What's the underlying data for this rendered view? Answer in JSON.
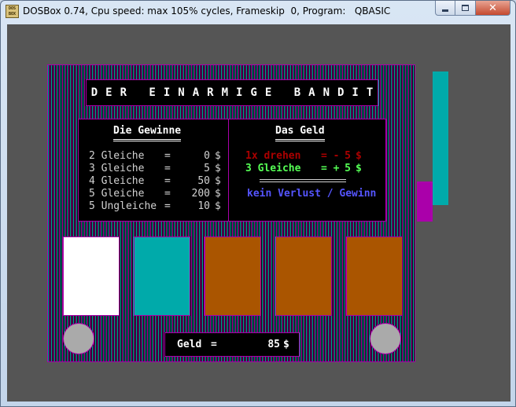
{
  "window": {
    "title": "DOSBox 0.74, Cpu speed: max 105% cycles, Frameskip  0, Program:   QBASIC",
    "icon_text": "DOS BOX",
    "controls": [
      "minimize",
      "maximize",
      "close"
    ]
  },
  "game": {
    "title": "DER EINARMIGE BANDIT",
    "payouts_heading": "Die Gewinne",
    "payouts": [
      {
        "name": "2 Gleiche",
        "eq": "=",
        "value": "0",
        "currency": "$"
      },
      {
        "name": "3 Gleiche",
        "eq": "=",
        "value": "5",
        "currency": "$"
      },
      {
        "name": "4 Gleiche",
        "eq": "=",
        "value": "50",
        "currency": "$"
      },
      {
        "name": "5 Gleiche",
        "eq": "=",
        "value": "200",
        "currency": "$"
      },
      {
        "name": "5 Ungleiche",
        "eq": "=",
        "value": "10",
        "currency": "$"
      }
    ],
    "money_heading": "Das Geld",
    "cost": {
      "label": "1x drehen",
      "sign": "= -",
      "value": "5",
      "currency": "$"
    },
    "win": {
      "label": "3 Gleiche",
      "sign": "= +",
      "value": "5",
      "currency": "$"
    },
    "result": "kein Verlust / Gewinn",
    "reels": [
      {
        "color": "#ffffff"
      },
      {
        "color": "#00aaaa"
      },
      {
        "color": "#aa5500"
      },
      {
        "color": "#aa5500"
      },
      {
        "color": "#aa5500"
      }
    ],
    "balance": {
      "label": "Geld",
      "eq": "=",
      "value": "85",
      "currency": "$"
    }
  },
  "colors": {
    "background": "#555555",
    "frame_stripe_1": "#00aaaa",
    "frame_stripe_2": "#aa00aa",
    "title_text": "#ffffff",
    "cost_text": "#aa0000",
    "win_text": "#55ff55",
    "result_text": "#5555ff",
    "knob": "#aaaaaa",
    "lever_arm": "#00aaaa",
    "lever_base": "#aa00aa"
  }
}
